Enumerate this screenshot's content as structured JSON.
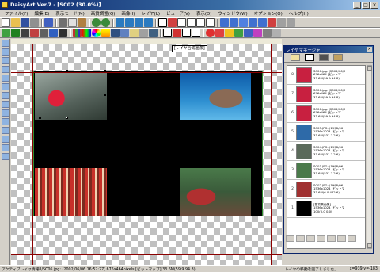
{
  "window": {
    "title": "DaisyArt Ver.7 - [SC02 (30.0%)]",
    "controls": [
      "_",
      "□",
      "×"
    ]
  },
  "menubar": [
    "ファイル(F)",
    "編集(E)",
    "表示モード(M)",
    "画質調整(Q)",
    "画像(I)",
    "レイヤ(L)",
    "ビューア(V)",
    "表示(D)",
    "ウィンドウ(W)",
    "オプション(O)",
    "ヘルプ(H)"
  ],
  "toolbar1_icons": [
    "new-icon",
    "open-icon",
    "save-icon",
    "print-icon",
    "undo-icon",
    "cut-icon",
    "copy-icon",
    "paste-icon",
    "zoom-in-icon",
    "zoom-out-icon",
    "home-icon",
    "home-icon",
    "home-icon",
    "home-icon",
    "palette-icon",
    "tool-icon",
    "tool-icon",
    "tool-icon",
    "tool-icon",
    "tool-icon",
    "tool-icon",
    "tool-icon",
    "tool-icon",
    "tool-icon",
    "tool-icon",
    "tool-icon",
    "tool-icon",
    "tool-icon"
  ],
  "toolbar2_icons": [
    "stamp-icon",
    "clover-icon",
    "effect-icon",
    "effect-icon",
    "effect-icon",
    "grid-icon",
    "rgb-icon",
    "color-icon",
    "color-icon",
    "color-icon",
    "filter-icon",
    "filter-icon",
    "filter-icon",
    "filter-icon",
    "select-icon",
    "brush-icon",
    "brush-icon",
    "select-icon",
    "fill-icon",
    "shape-icon",
    "shape-icon",
    "shape-icon",
    "shape-icon",
    "shape-icon",
    "shape-icon",
    "lock-icon"
  ],
  "canvas": {
    "layer_label": "[レイヤ合成画像]"
  },
  "layer_manager": {
    "title": "レイヤマネージャ",
    "close": "×",
    "layers": [
      {
        "num": "8",
        "info": "SC06.jpg: (2002/06/0\n676x464 [ビットマ\n33.6M(59.9 94.8)",
        "color": "#c82040"
      },
      {
        "num": "7",
        "info": "SC06.jpg: (2002/06/0\n676x464 [ビットマ\n33.6M(59.9 94.8)",
        "color": "#c82040"
      },
      {
        "num": "6",
        "info": "SC06.jpg: (2002/06/0\n676x464 [ビットマ\n33.6M(59.9 94.8)",
        "color": "#c82040"
      },
      {
        "num": "5",
        "info": "SC05.JPG: (1998/06\n1536x1024 [ビットマ\n33.6M(531.7 2.6)",
        "color": "#2e6aa8"
      },
      {
        "num": "4",
        "info": "SC04.JPG: (1998/06\n1536x1024 [ビットマ\n33.6M(531.7 2.6)",
        "color": "#5a6a5a"
      },
      {
        "num": "3",
        "info": "SC03.JPG: (1998/06\n1536x1024 [ビットマ\n33.6M(531.7 2.6)",
        "color": "#4a7a4a"
      },
      {
        "num": "2",
        "info": "SC02.JPG: (1998/06\n1536x1024 [ビットマ\n33.6M(6.0 462.6)",
        "color": "#a03030"
      },
      {
        "num": "1",
        "info": "[色背景画像]\n1536x1024 [ビットマ\n100(0.0 0.0)",
        "color": "#000000"
      }
    ]
  },
  "status": {
    "left": "アクティブレイヤ情報8/SC06.jpg: (2002/06/06 16:52:27) 676x464pixels [ビットマップ] 33.6M(59.9 94.8)",
    "mid": "レイヤの移動を完了しました。",
    "right": "x=939 y=-183"
  }
}
